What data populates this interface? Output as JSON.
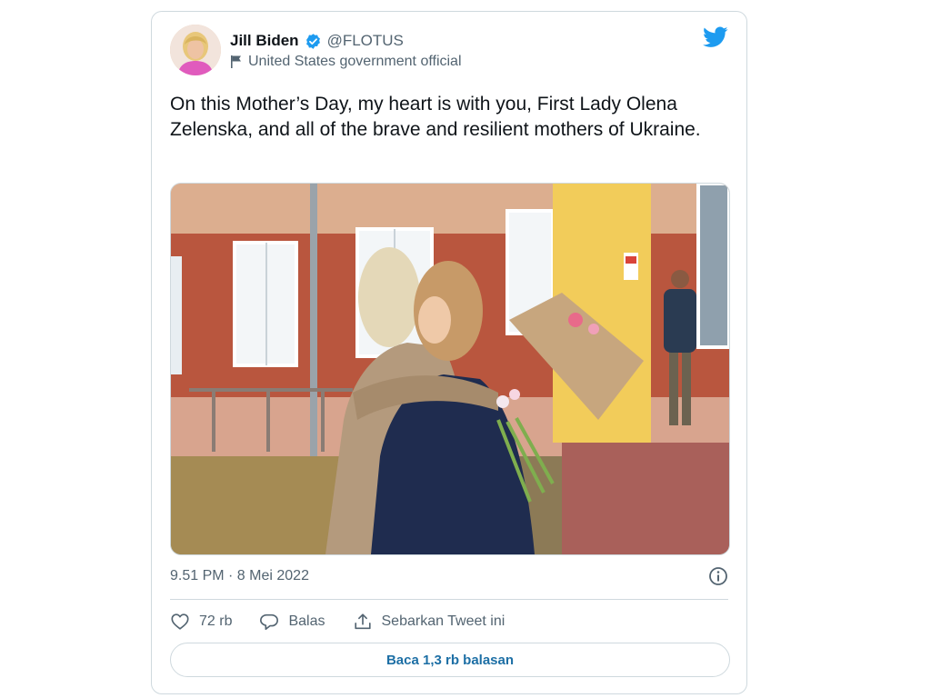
{
  "author": {
    "name": "Jill Biden",
    "handle": "@FLOTUS",
    "affiliation": "United States government official"
  },
  "tweet": {
    "text": "On this Mother’s Day, my heart is with you, First Lady Olena Zelenska, and all of the brave and resilient mothers of Ukraine.",
    "timestamp": "9.51 PM · 8 Mei 2022"
  },
  "actions": {
    "likes_count": "72 rb",
    "reply_label": "Balas",
    "share_label": "Sebarkan Tweet ini"
  },
  "read_replies_label": "Baca 1,3 rb balasan",
  "colors": {
    "twitter_blue": "#1d9bf0",
    "text_primary": "#0f1419",
    "text_secondary": "#536471",
    "border": "#cfd9de",
    "link_blue": "#1d6fa5"
  },
  "icons": [
    "verified-badge-icon",
    "government-flag-icon",
    "twitter-bird-icon",
    "info-icon",
    "heart-icon",
    "reply-bubble-icon",
    "share-icon"
  ]
}
